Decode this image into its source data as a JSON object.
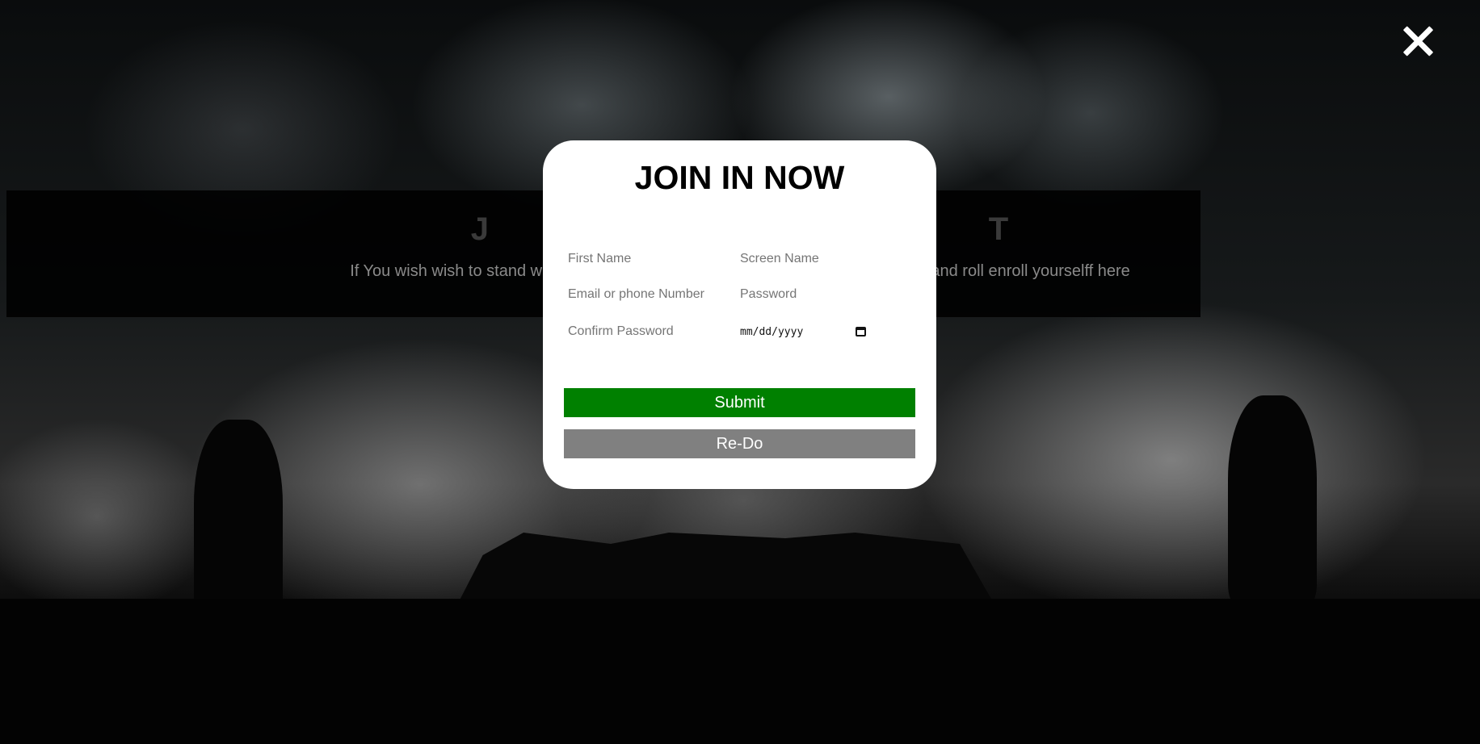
{
  "background": {
    "heading": "J                                                   T",
    "subtext": "If You wish wish to stand with us and                                                       ar of rock and roll enroll yourselff here"
  },
  "close_icon": "close-icon",
  "modal": {
    "title": "JOIN IN NOW",
    "fields": {
      "first_name_placeholder": "First Name",
      "screen_name_placeholder": "Screen Name",
      "email_placeholder": "Email or phone Number",
      "password_placeholder": "Password",
      "confirm_password_placeholder": "Confirm Password",
      "date_placeholder": "mm/dd/yyyy"
    },
    "submit_label": "Submit",
    "redo_label": "Re-Do"
  },
  "colors": {
    "submit": "#008000",
    "redo": "#808080",
    "modal_bg": "#ffffff"
  }
}
